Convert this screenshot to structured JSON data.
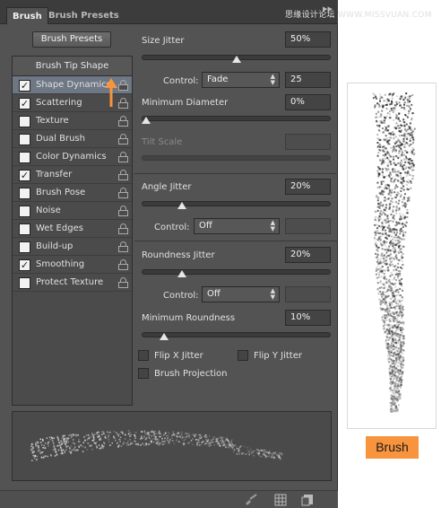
{
  "tabs": [
    {
      "label": "Brush",
      "active": true
    },
    {
      "label": "Brush Presets",
      "active": false
    }
  ],
  "watermark": "思缘设计论坛 WWW.MISSVUAN.COM",
  "brush_presets_button": "Brush Presets",
  "brush_tip_shape_header": "Brush Tip Shape",
  "tip_items": [
    {
      "label": "Shape Dynamics",
      "checked": true,
      "selected": true
    },
    {
      "label": "Scattering",
      "checked": true,
      "selected": false
    },
    {
      "label": "Texture",
      "checked": false,
      "selected": false
    },
    {
      "label": "Dual Brush",
      "checked": false,
      "selected": false
    },
    {
      "label": "Color Dynamics",
      "checked": false,
      "selected": false
    },
    {
      "label": "Transfer",
      "checked": true,
      "selected": false
    },
    {
      "label": "Brush Pose",
      "checked": false,
      "selected": false
    },
    {
      "label": "Noise",
      "checked": false,
      "selected": false
    },
    {
      "label": "Wet Edges",
      "checked": false,
      "selected": false
    },
    {
      "label": "Build-up",
      "checked": false,
      "selected": false
    },
    {
      "label": "Smoothing",
      "checked": true,
      "selected": false
    },
    {
      "label": "Protect Texture",
      "checked": false,
      "selected": false
    }
  ],
  "checkmark_glyph": "✓",
  "settings": {
    "size_jitter": {
      "label": "Size Jitter",
      "value": "50%",
      "slider_fraction": 0.5
    },
    "size_control": {
      "label": "Control:",
      "selected": "Fade",
      "value": "25"
    },
    "minimum_diameter": {
      "label": "Minimum Diameter",
      "value": "0%",
      "slider_fraction": 0.0
    },
    "tilt_scale": {
      "label": "Tilt Scale",
      "value": "",
      "disabled": true
    },
    "angle_jitter": {
      "label": "Angle Jitter",
      "value": "20%",
      "slider_fraction": 0.2
    },
    "angle_control": {
      "label": "Control:",
      "selected": "Off"
    },
    "roundness_jitter": {
      "label": "Roundness Jitter",
      "value": "20%",
      "slider_fraction": 0.2
    },
    "roundness_control": {
      "label": "Control:",
      "selected": "Off"
    },
    "minimum_roundness": {
      "label": "Minimum Roundness",
      "value": "10%",
      "slider_fraction": 0.1
    },
    "flip_x": {
      "label": "Flip X Jitter",
      "checked": false
    },
    "flip_y": {
      "label": "Flip Y Jitter",
      "checked": false
    },
    "brush_projection": {
      "label": "Brush Projection",
      "checked": false
    }
  },
  "bottom_icons": [
    "brush-edit-icon",
    "grid-icon",
    "new-brush-icon"
  ],
  "stroke_caption": "Brush",
  "colors": {
    "accent": "#f8943d",
    "panel": "#535353",
    "selected_row": "#6e7784"
  }
}
